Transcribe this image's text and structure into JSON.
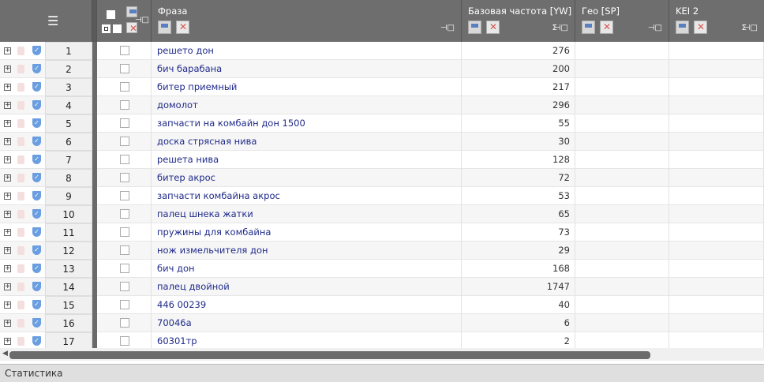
{
  "columns": {
    "phrase": "Фраза",
    "frequency": "Базовая частота [YW]",
    "geo": "Гео [SP]",
    "kei": "KEI 2",
    "sum_symbol": "Σ",
    "pin_symbol": "⊣□"
  },
  "rows": [
    {
      "n": "1",
      "phrase": "решето дон",
      "freq": "276"
    },
    {
      "n": "2",
      "phrase": "бич барабана",
      "freq": "200"
    },
    {
      "n": "3",
      "phrase": "битер приемный",
      "freq": "217"
    },
    {
      "n": "4",
      "phrase": "домолот",
      "freq": "296"
    },
    {
      "n": "5",
      "phrase": "запчасти на комбайн дон 1500",
      "freq": "55"
    },
    {
      "n": "6",
      "phrase": "доска стрясная нива",
      "freq": "30"
    },
    {
      "n": "7",
      "phrase": "решета нива",
      "freq": "128"
    },
    {
      "n": "8",
      "phrase": "битер акрос",
      "freq": "72"
    },
    {
      "n": "9",
      "phrase": "запчасти комбайна акрос",
      "freq": "53"
    },
    {
      "n": "10",
      "phrase": "палец шнека жатки",
      "freq": "65"
    },
    {
      "n": "11",
      "phrase": "пружины для комбайна",
      "freq": "73"
    },
    {
      "n": "12",
      "phrase": "нож измельчителя дон",
      "freq": "29"
    },
    {
      "n": "13",
      "phrase": "бич дон",
      "freq": "168"
    },
    {
      "n": "14",
      "phrase": "палец двойной",
      "freq": "1747"
    },
    {
      "n": "15",
      "phrase": "446 00239",
      "freq": "40"
    },
    {
      "n": "16",
      "phrase": "70046а",
      "freq": "6"
    },
    {
      "n": "17",
      "phrase": "60301тр",
      "freq": "2"
    }
  ],
  "status_bar": "Статистика"
}
